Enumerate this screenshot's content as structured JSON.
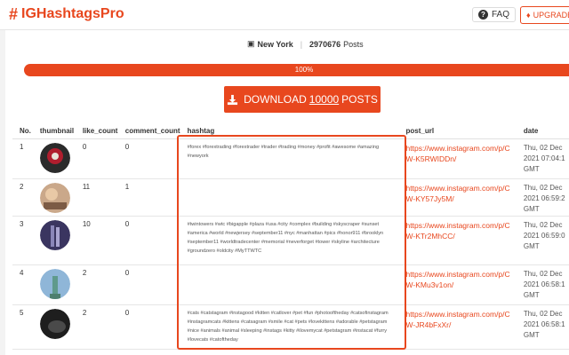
{
  "app": {
    "brand_symbol": "#",
    "brand_name": "IGHashtagsPro",
    "faq_label": "FAQ",
    "upgrade_label": "UPGRADE TO"
  },
  "summary": {
    "location": "New York",
    "separator": "|",
    "posts_count": "2970676",
    "posts_label": "Posts"
  },
  "progress": {
    "value": 1.0,
    "label": "100%"
  },
  "download": {
    "prefix": "DOWNLOAD",
    "number": "10000",
    "suffix": "POSTS"
  },
  "table": {
    "headers": [
      "No.",
      "thumbnail",
      "like_count",
      "comment_count",
      "hashtag",
      "post_url",
      "date"
    ],
    "rows": [
      {
        "no": "1",
        "likes": "0",
        "comments": "0",
        "hashtag": "#forex #forextrading #forextrader #trader #trading #money #profit #awesome #amazing #newyork",
        "url": "https://www.instagram.com/p/CW-K5RWIDDn/",
        "date": "Thu, 02 Dec 2021 07:04:1 GMT"
      },
      {
        "no": "2",
        "likes": "11",
        "comments": "1",
        "hashtag": "",
        "url": "https://www.instagram.com/p/CW-KY57Jy5M/",
        "date": "Thu, 02 Dec 2021 06:59:2 GMT"
      },
      {
        "no": "3",
        "likes": "10",
        "comments": "0",
        "hashtag": "#twintowers #wtc #bigapple #plaza #usa #city #complex #building #skyscraper #sunset #america #world #newjersey #september11 #nyc #manhattan #pics #honor911 #brooklyn #september11 #worldtradecenter #memorial #neverforget #tower #skyline #architecture #groundzero #oldcity #MyTTWTC",
        "url": "https://www.instagram.com/p/CW-KTr2MhCC/",
        "date": "Thu, 02 Dec 2021 06:59:0 GMT"
      },
      {
        "no": "4",
        "likes": "2",
        "comments": "0",
        "hashtag": "",
        "url": "https://www.instagram.com/p/CW-KMu3v1on/",
        "date": "Thu, 02 Dec 2021 06:58:1 GMT"
      },
      {
        "no": "5",
        "likes": "2",
        "comments": "0",
        "hashtag": "#cats #catstagram #instagood #kitten #catlover #pet #fun #photooftheday #catsofinstagram #instagramcats #kittens #catsagram #smile #cat #pets #lovekittens #adorable #petstagram #nice #animals #animal #sleeping #instags #kitty #ilovemycat #petstagram #instacat #furry #lovecats #catoftheday",
        "url": "https://www.instagram.com/p/CW-JR4bFxXr/",
        "date": "Thu, 02 Dec 2021 06:58:1 GMT"
      }
    ]
  },
  "colors": {
    "accent": "#e8471e"
  },
  "icons": {
    "brand": "hash-icon",
    "faq": "question-circle-icon",
    "upgrade": "gem-icon",
    "location": "building-icon",
    "download": "download-icon"
  }
}
